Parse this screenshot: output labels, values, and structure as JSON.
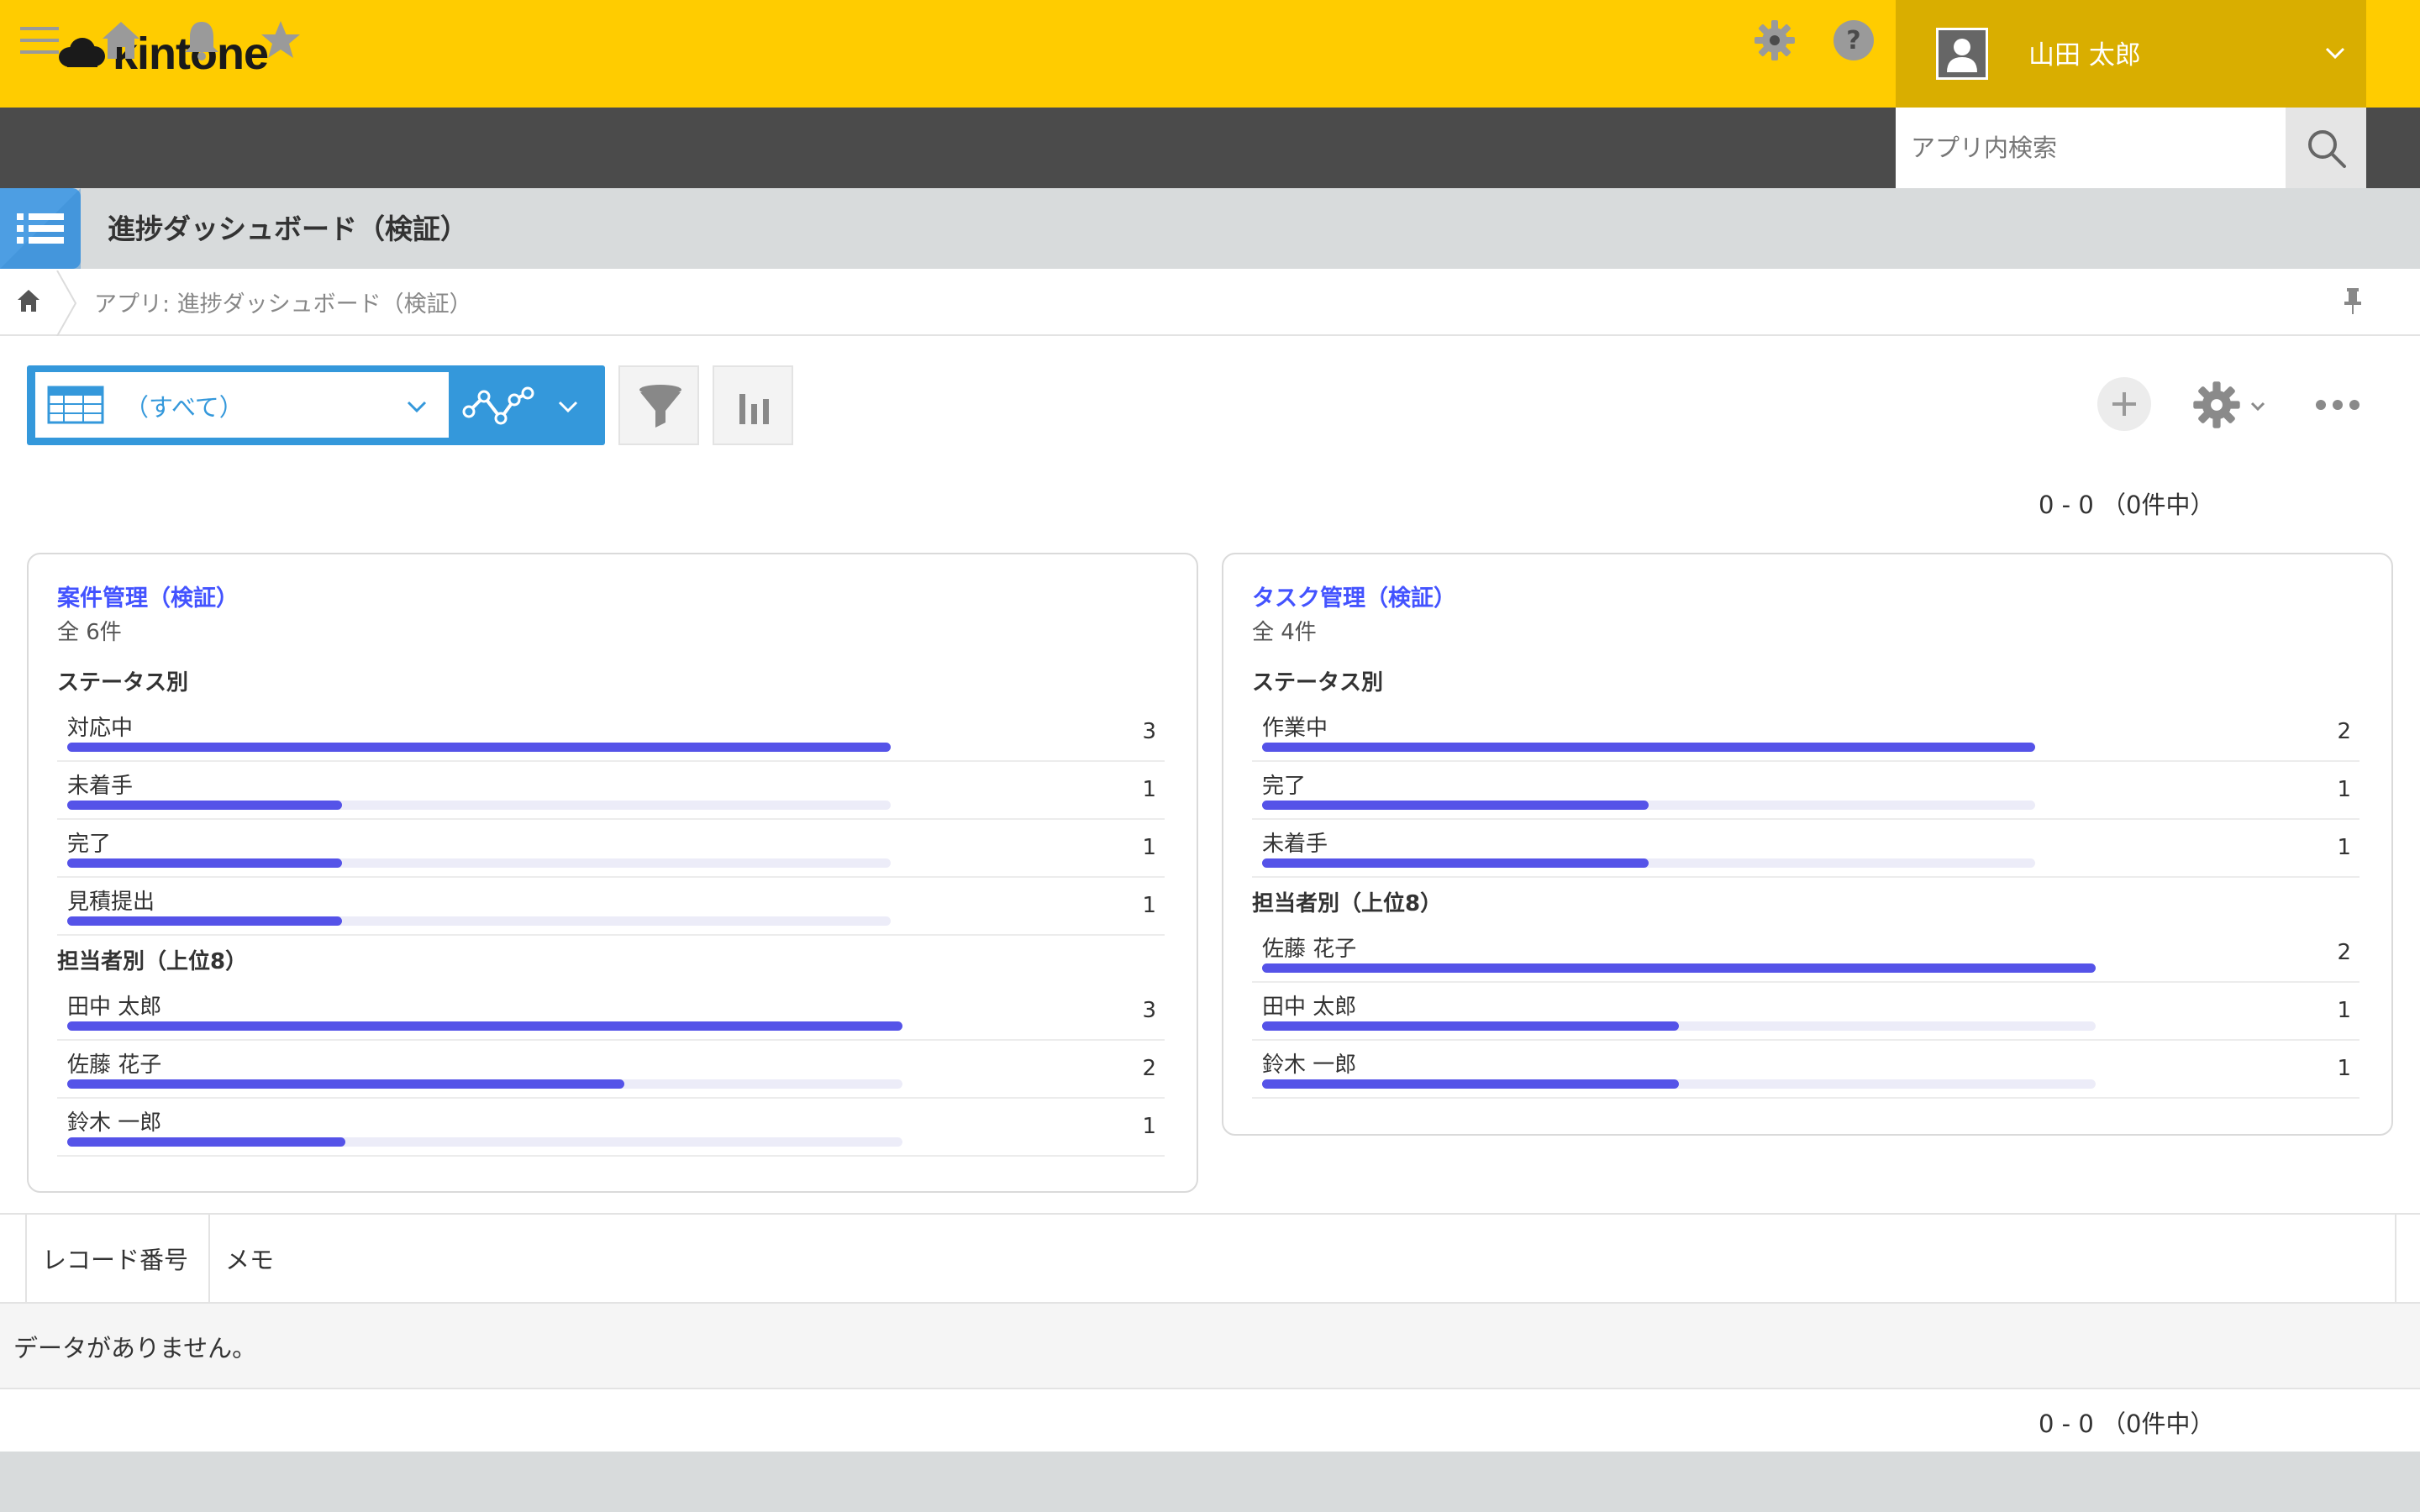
{
  "header": {
    "logo_text": "kintone",
    "user_name": "山田 太郎"
  },
  "nav": {
    "search_placeholder": "アプリ内検索"
  },
  "app": {
    "title": "進捗ダッシュボード（検証）",
    "breadcrumb": "アプリ: 進捗ダッシュボード（検証）"
  },
  "toolbar": {
    "view_label": "（すべて）"
  },
  "pager": {
    "top": "0 - 0 （0件中）",
    "bottom": "0 - 0 （0件中）"
  },
  "cards": [
    {
      "title": "案件管理（検証）",
      "total": "全 6件",
      "sections": [
        {
          "title": "ステータス別",
          "max": 3,
          "rows": [
            {
              "label": "対応中",
              "count": 3
            },
            {
              "label": "未着手",
              "count": 1
            },
            {
              "label": "完了",
              "count": 1
            },
            {
              "label": "見積提出",
              "count": 1
            }
          ]
        },
        {
          "title": "担当者別（上位8）",
          "max": 3,
          "rows": [
            {
              "label": "田中 太郎",
              "count": 3
            },
            {
              "label": "佐藤 花子",
              "count": 2
            },
            {
              "label": "鈴木 一郎",
              "count": 1
            }
          ]
        }
      ]
    },
    {
      "title": "タスク管理（検証）",
      "total": "全 4件",
      "sections": [
        {
          "title": "ステータス別",
          "max": 2,
          "rows": [
            {
              "label": "作業中",
              "count": 2
            },
            {
              "label": "完了",
              "count": 1
            },
            {
              "label": "未着手",
              "count": 1
            }
          ]
        },
        {
          "title": "担当者別（上位8）",
          "max": 2,
          "rows": [
            {
              "label": "佐藤 花子",
              "count": 2
            },
            {
              "label": "田中 太郎",
              "count": 1
            },
            {
              "label": "鈴木 一郎",
              "count": 1
            }
          ]
        }
      ]
    }
  ],
  "table": {
    "columns": [
      "レコード番号",
      "メモ"
    ],
    "empty_text": "データがありません。"
  },
  "colors": {
    "header_yellow": "#ffcc00",
    "nav_dark": "#4b4b4b",
    "accent_blue": "#3498db",
    "bar_fill": "#5553e8",
    "card_title": "#4353ff"
  }
}
